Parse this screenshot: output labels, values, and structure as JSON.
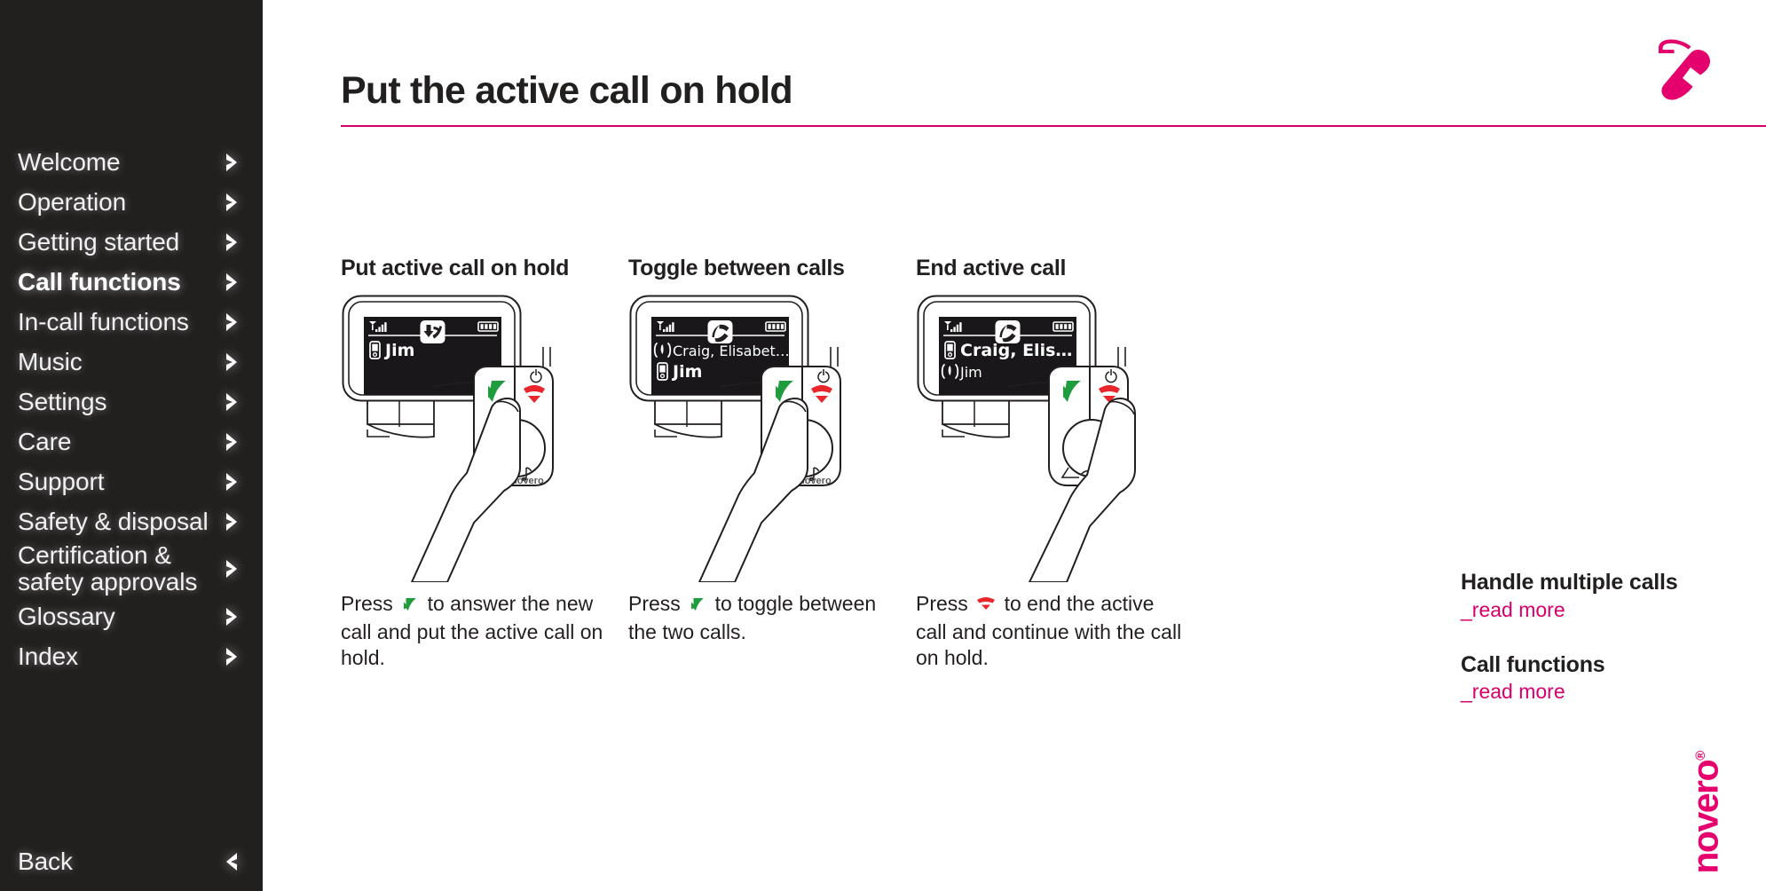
{
  "sidebar": {
    "items": [
      {
        "label": "Welcome",
        "active": false,
        "icon": "chevron-right-icon"
      },
      {
        "label": "Operation",
        "active": false,
        "icon": "chevron-right-icon"
      },
      {
        "label": "Getting started",
        "active": false,
        "icon": "chevron-right-icon"
      },
      {
        "label": "Call functions",
        "active": true,
        "icon": "chevron-right-icon"
      },
      {
        "label": "In-call functions",
        "active": false,
        "icon": "chevron-right-icon"
      },
      {
        "label": "Music",
        "active": false,
        "icon": "chevron-right-icon"
      },
      {
        "label": "Settings",
        "active": false,
        "icon": "chevron-right-icon"
      },
      {
        "label": "Care",
        "active": false,
        "icon": "chevron-right-icon"
      },
      {
        "label": "Support",
        "active": false,
        "icon": "chevron-right-icon"
      },
      {
        "label": "Safety & disposal",
        "active": false,
        "icon": "chevron-right-icon"
      },
      {
        "label": "Certification &\nsafety approvals",
        "active": false,
        "icon": "chevron-right-icon",
        "two_line": true
      },
      {
        "label": "Glossary",
        "active": false,
        "icon": "chevron-right-icon"
      },
      {
        "label": "Index",
        "active": false,
        "icon": "chevron-right-icon"
      }
    ],
    "back": {
      "label": "Back",
      "icon": "chevron-left-icon"
    },
    "bg_color": "#221f1f",
    "text_color": "#f2f2f2"
  },
  "header": {
    "title": "Put the active call on hold",
    "rule_color": "#d6006c",
    "icon": "phone-handset-icon"
  },
  "columns": [
    {
      "title": "Put active call on hold",
      "screen": {
        "status": {
          "signal": "signal-bars-icon",
          "center": "incoming-call-icon",
          "battery": "battery-full-icon"
        },
        "lines": [
          {
            "icon": "handset-device-icon",
            "text": "Jim",
            "bold": true
          }
        ]
      },
      "pressed_key": "green-call-key",
      "caption_pre": "Press",
      "caption_icon": "green-call-key-icon",
      "caption_post": "to answer the new call and put the active call on hold."
    },
    {
      "title": "Toggle between calls",
      "screen": {
        "status": {
          "signal": "signal-bars-icon",
          "center": "active-call-icon",
          "battery": "battery-full-icon"
        },
        "lines": [
          {
            "icon": "call-on-hold-icon",
            "text": "Craig, Elisabet…",
            "bold": false
          },
          {
            "icon": "handset-device-icon",
            "text": "Jim",
            "bold": true
          }
        ]
      },
      "pressed_key": "green-call-key",
      "caption_pre": "Press",
      "caption_icon": "green-call-key-icon",
      "caption_post": "to toggle between the two calls."
    },
    {
      "title": "End active call",
      "screen": {
        "status": {
          "signal": "signal-bars-icon",
          "center": "active-call-icon",
          "battery": "battery-full-icon"
        },
        "lines": [
          {
            "icon": "handset-device-icon",
            "text": "Craig, Elis…",
            "bold": true
          },
          {
            "icon": "call-on-hold-icon",
            "text": "Jim",
            "bold": false
          }
        ]
      },
      "pressed_key": "red-end-key",
      "caption_pre": "Press",
      "caption_icon": "red-end-key-icon",
      "caption_post": "to end the active call and continue with the call on hold."
    }
  ],
  "device": {
    "power_icon": "power-icon",
    "music_icon": "music-note-icon",
    "brand": "novero",
    "green_key_color": "#1f9c3d",
    "red_key_color": "#e8262c"
  },
  "right_rail": [
    {
      "title": "Handle multiple calls",
      "link": "_read more"
    },
    {
      "title": "Call functions",
      "link": "_read more"
    }
  ],
  "logo": {
    "text": "novero",
    "mark": "®",
    "color": "#e6006e"
  }
}
